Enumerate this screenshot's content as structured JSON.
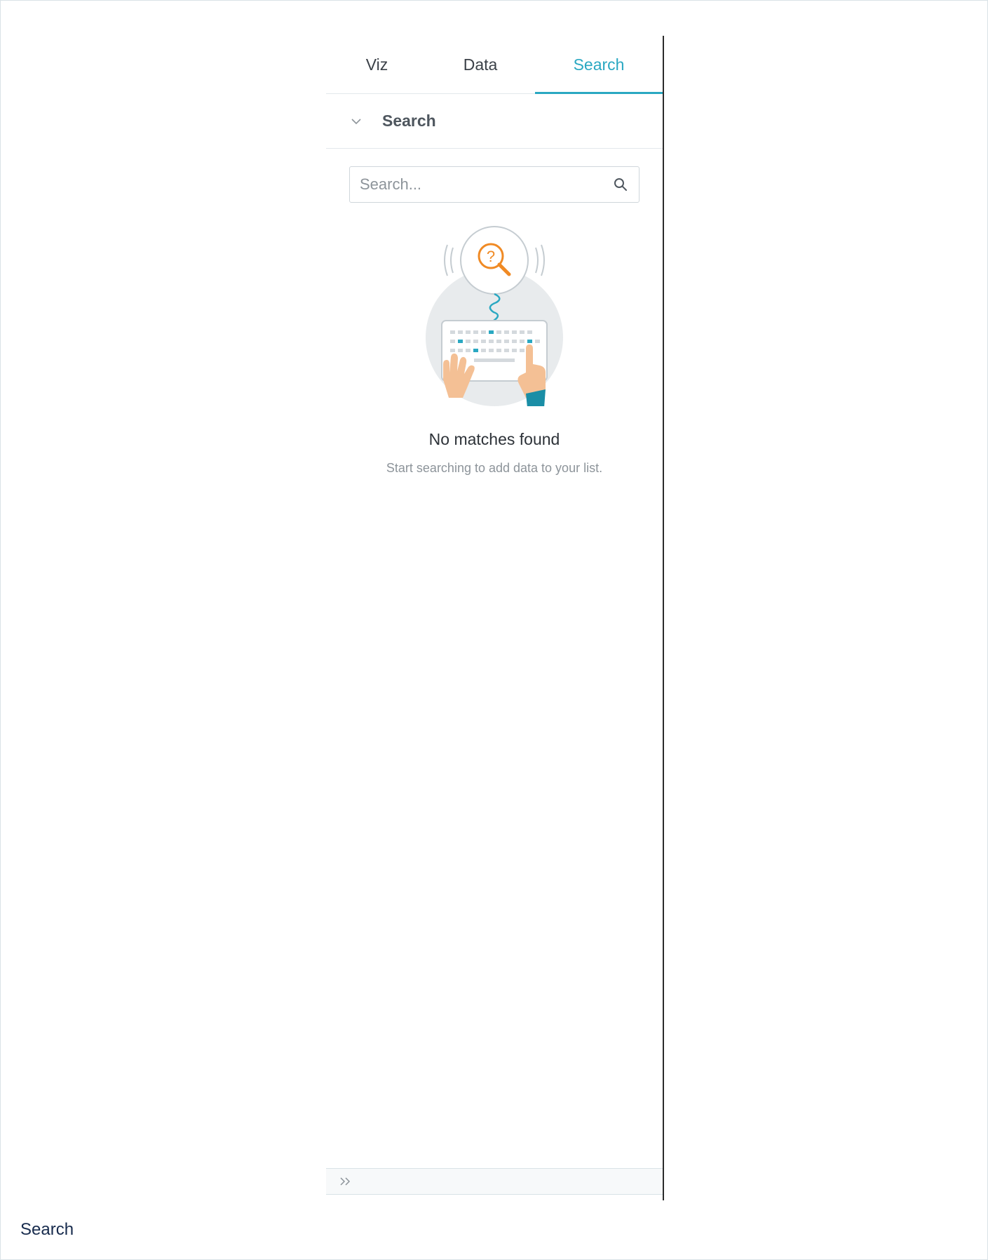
{
  "tabs": [
    {
      "label": "Viz",
      "active": false
    },
    {
      "label": "Data",
      "active": false
    },
    {
      "label": "Search",
      "active": true
    }
  ],
  "section": {
    "title": "Search",
    "expanded": true
  },
  "search": {
    "placeholder": "Search...",
    "value": ""
  },
  "empty_state": {
    "title": "No matches found",
    "subtitle": "Start searching to add data to your list."
  },
  "footer": {
    "icon": "double-chevron-right-icon"
  },
  "caption": "Search",
  "colors": {
    "accent": "#2aa8c2",
    "illustration_orange": "#f08a24",
    "skin": "#f4c095",
    "divider": "#2b2b2b"
  }
}
